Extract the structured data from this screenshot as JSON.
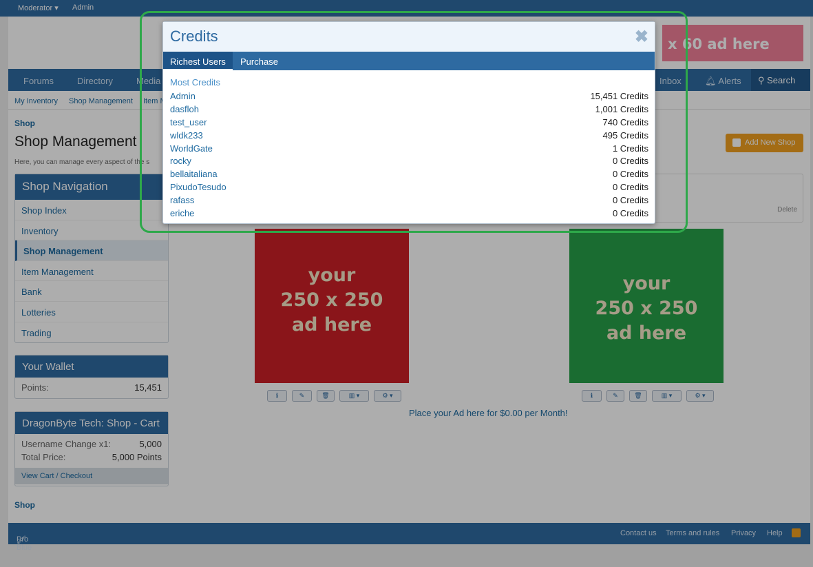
{
  "topbar": {
    "moderator": "Moderator ▾",
    "admin": "Admin"
  },
  "banner": {
    "text": "x 60 ad here"
  },
  "nav": {
    "items": [
      "Forums",
      "Directory",
      "Media"
    ],
    "inbox": "Inbox",
    "alerts": "Alerts",
    "search": "Search"
  },
  "subnav": {
    "items": [
      "My Inventory",
      "Shop Management",
      "Item M"
    ]
  },
  "breadcrumb": {
    "top": "Shop",
    "bottom": "Shop"
  },
  "page": {
    "title": "Shop Management",
    "description": "Here, you can manage every aspect of the s",
    "add_shop": "Add New Shop",
    "delete": "Delete"
  },
  "shop_nav": {
    "title": "Shop Navigation",
    "items": [
      "Shop Index",
      "Inventory",
      "Shop Management",
      "Item Management",
      "Bank",
      "Lotteries",
      "Trading"
    ],
    "active_index": 2
  },
  "wallet": {
    "title": "Your Wallet",
    "label": "Points:",
    "value": "15,451"
  },
  "cart": {
    "title": "DragonByte Tech: Shop - Cart",
    "item_label": "Username Change x1:",
    "item_value": "5,000",
    "total_label": "Total Price:",
    "total_value": "5,000 Points",
    "checkout": "View Cart / Checkout"
  },
  "ads": {
    "line1": "your",
    "line2": "250 x 250",
    "line3": "ad here",
    "red": "#cc2027",
    "green": "#27a049",
    "place_text": "Place your Ad here for $0.00 per Month!"
  },
  "footer": {
    "style": "Pro Blue",
    "links": [
      "Contact us",
      "Terms and rules",
      "Privacy",
      "Help"
    ]
  },
  "modal": {
    "title": "Credits",
    "close": "✖",
    "tabs": [
      "Richest Users",
      "Purchase"
    ],
    "active_tab": 0,
    "section": "Most Credits",
    "users": [
      {
        "name": "Admin",
        "credits": "15,451 Credits"
      },
      {
        "name": "dasfloh",
        "credits": "1,001 Credits"
      },
      {
        "name": "test_user",
        "credits": "740 Credits"
      },
      {
        "name": "wldk233",
        "credits": "495 Credits"
      },
      {
        "name": "WorldGate",
        "credits": "1 Credits"
      },
      {
        "name": "rocky",
        "credits": "0 Credits"
      },
      {
        "name": "bellaitaliana",
        "credits": "0 Credits"
      },
      {
        "name": "PixudoTesudo",
        "credits": "0 Credits"
      },
      {
        "name": "rafass",
        "credits": "0 Credits"
      },
      {
        "name": "eriche",
        "credits": "0 Credits"
      }
    ]
  }
}
